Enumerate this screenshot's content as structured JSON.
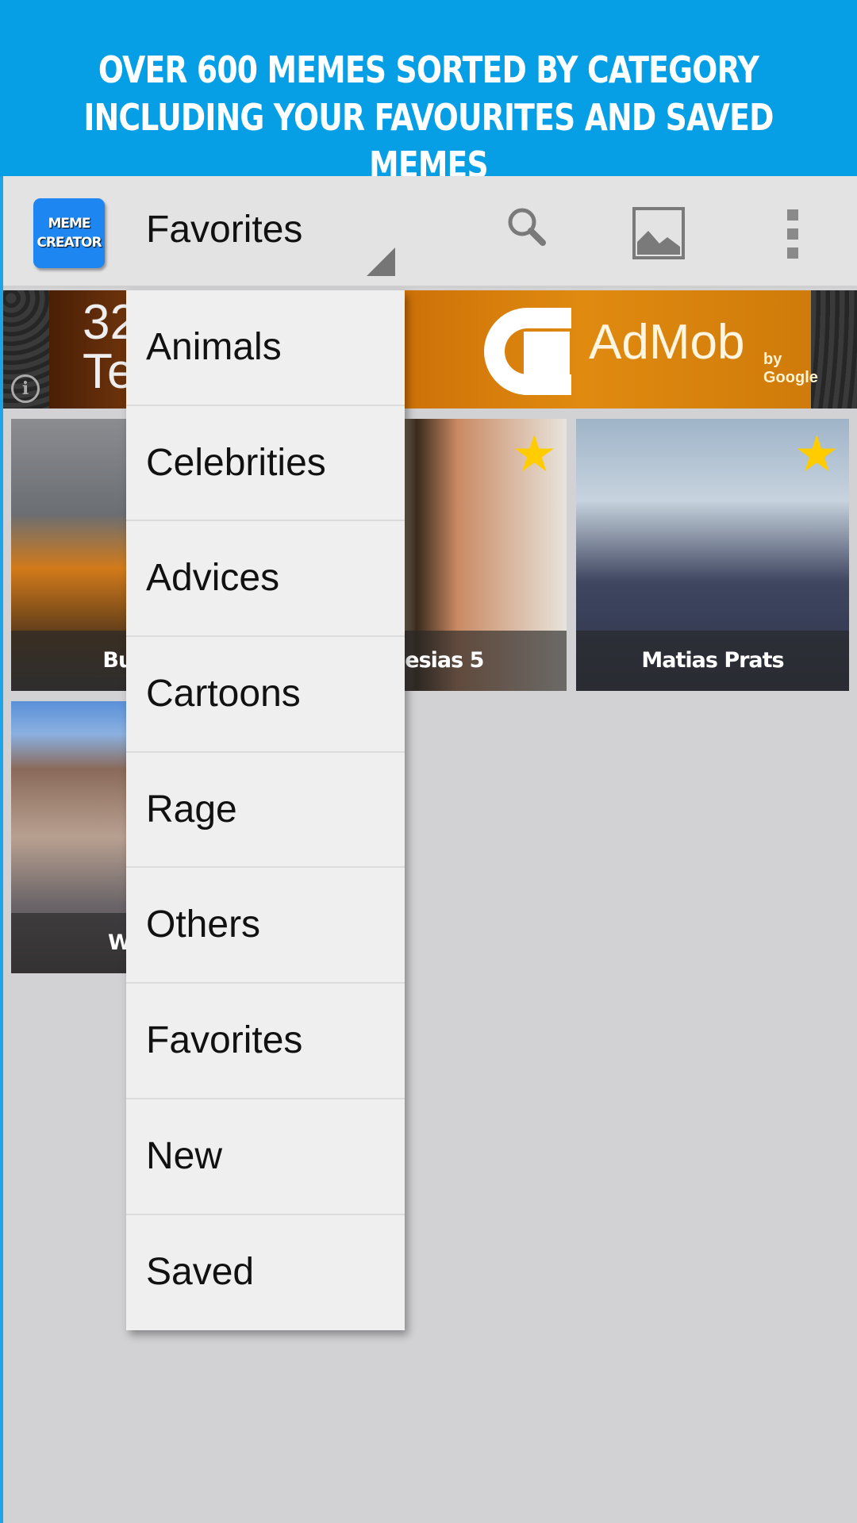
{
  "promo": {
    "line1": "OVER 600 MEMES SORTED BY CATEGORY",
    "line2": "INCLUDING YOUR FAVOURITES AND SAVED MEMES"
  },
  "appbar": {
    "logo_line1": "MEME",
    "logo_line2": "CREATOR",
    "title": "Favorites",
    "icons": [
      "search-icon",
      "image-icon",
      "overflow-menu-icon"
    ]
  },
  "ad": {
    "left_text_1": "32",
    "left_text_2": "Te",
    "brand": "AdMob",
    "brand_sub": "by Google"
  },
  "tiles": [
    {
      "caption": "Burning",
      "favorite": false
    },
    {
      "caption": "Iglesias 5",
      "favorite": true
    },
    {
      "caption": "Matias Prats",
      "favorite": true
    },
    {
      "caption": "W",
      "favorite": false
    }
  ],
  "menu": {
    "items": [
      "Animals",
      "Celebrities",
      "Advices",
      "Cartoons",
      "Rage",
      "Others",
      "Favorites",
      "New",
      "Saved"
    ]
  },
  "colors": {
    "promo_bg": "#069fe6",
    "logo_bg": "#1e86f0",
    "star": "#ffcc00"
  }
}
